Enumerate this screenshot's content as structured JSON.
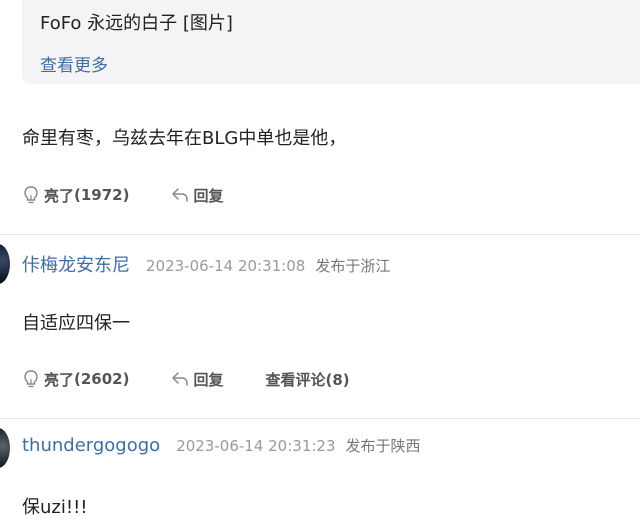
{
  "quote": {
    "text": "FoFo 永远的白子 [图片]",
    "more_label": "查看更多"
  },
  "top_reply": {
    "body": "命里有枣，乌兹去年在BLG中单也是他，",
    "like_label": "亮了",
    "like_count": "(1972)",
    "reply_label": "回复"
  },
  "comments": [
    {
      "username": "佧梅龙安东尼",
      "timestamp": "2023-06-14 20:31:08",
      "location": "发布于浙江",
      "body": "自适应四保一",
      "like_label": "亮了",
      "like_count": "(2602)",
      "reply_label": "回复",
      "view_comments_label": "查看评论(8)"
    },
    {
      "username": "thundergogogo",
      "timestamp": "2023-06-14 20:31:23",
      "location": "发布于陕西",
      "body": "保uzi!!!"
    }
  ],
  "icons": {
    "like": "lightbulb-icon",
    "reply": "reply-arrow-icon"
  },
  "colors": {
    "link": "#3c6fa6",
    "quote_bg": "#f4f4f6",
    "meta_gray": "#9a9a9a"
  }
}
